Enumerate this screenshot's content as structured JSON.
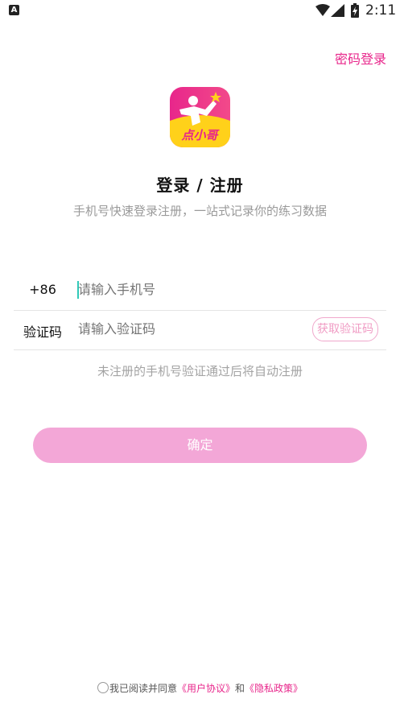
{
  "status_bar": {
    "left_icon": "A",
    "time": "2:11",
    "icons": [
      "notification-a-icon",
      "wifi-icon",
      "signal-icon",
      "battery-charging-icon"
    ]
  },
  "header": {
    "password_login": "密码登录"
  },
  "logo": {
    "name": "app-logo",
    "text": "点小哥"
  },
  "title": "登录 / 注册",
  "subtitle": "手机号快速登录注册，一站式记录你的练习数据",
  "form": {
    "country_code": "+86",
    "phone_placeholder": "请输入手机号",
    "code_label": "验证码",
    "code_placeholder": "请输入验证码",
    "get_code_button": "获取验证码",
    "hint": "未注册的手机号验证通过后将自动注册"
  },
  "confirm_button": "确定",
  "agreement": {
    "prefix": "我已阅读并同意",
    "user_agreement": "《用户协议》",
    "and": "和",
    "privacy_policy": "《隐私政策》"
  },
  "colors": {
    "accent": "#e8268b",
    "button_disabled": "#f3a7d7",
    "cursor": "#30c9b8"
  }
}
